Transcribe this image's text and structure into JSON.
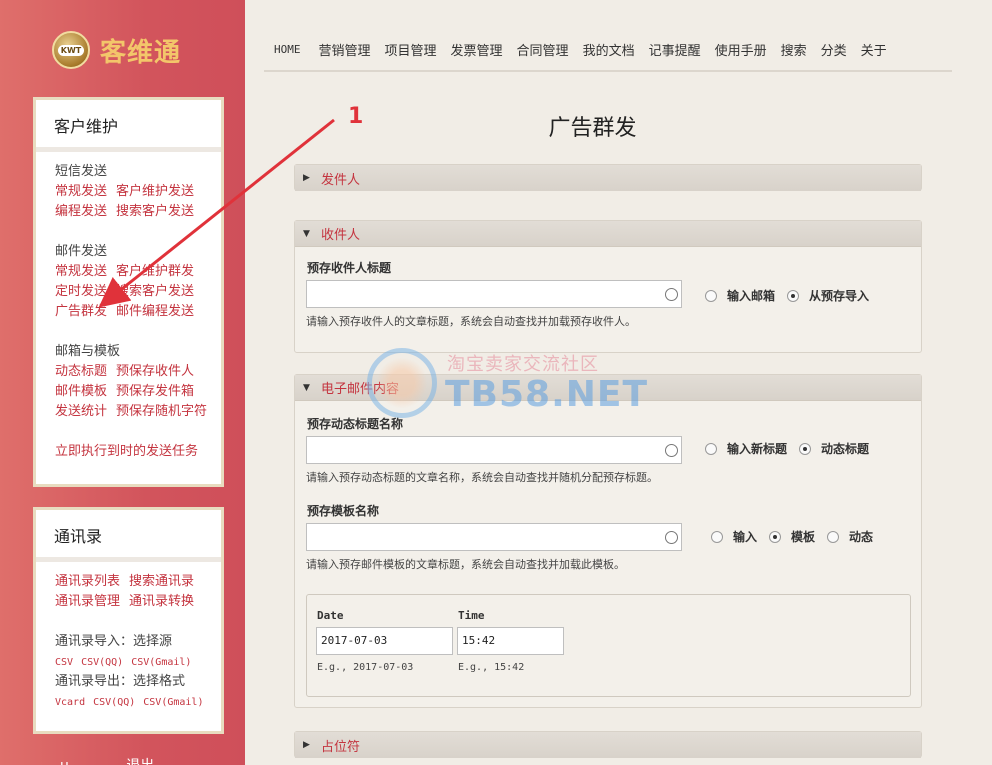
{
  "app": {
    "logo_badge": "KWT",
    "logo_text": "客维通"
  },
  "topnav": [
    "HOME",
    "营销管理",
    "项目管理",
    "发票管理",
    "合同管理",
    "我的文档",
    "记事提醒",
    "使用手册",
    "搜索",
    "分类",
    "关于"
  ],
  "page_title": "广告群发",
  "annotation": {
    "number": "1"
  },
  "sidebar": {
    "panel1": {
      "title": "客户维护",
      "sms_title": "短信发送",
      "sms_links": [
        [
          "常规发送",
          "客户维护发送"
        ],
        [
          "编程发送",
          "搜索客户发送"
        ]
      ],
      "mail_title": "邮件发送",
      "mail_links": [
        [
          "常规发送",
          "客户维护群发"
        ],
        [
          "定时发送",
          "搜索客户发送"
        ],
        [
          "广告群发",
          "邮件编程发送"
        ]
      ],
      "box_title": "邮箱与模板",
      "box_links": [
        [
          "动态标题",
          "预保存收件人"
        ],
        [
          "邮件模板",
          "预保存发件箱"
        ],
        [
          "发送统计",
          "预保存随机字符"
        ]
      ],
      "run_link": "立即执行到时的发送任务"
    },
    "panel2": {
      "title": "通讯录",
      "links": [
        [
          "通讯录列表",
          "搜索通讯录"
        ],
        [
          "通讯录管理",
          "通讯录转换"
        ]
      ],
      "import_title": "通讯录导入：选择源",
      "import_links": [
        "CSV",
        "CSV(QQ)",
        "CSV(Gmail)"
      ],
      "export_title": "通讯录导出：选择格式",
      "export_links": [
        "Vcard",
        "CSV(QQ)",
        "CSV(Gmail)"
      ]
    },
    "bottom": [
      "u",
      "...",
      "退出"
    ]
  },
  "sections": {
    "sender": {
      "label": "发件人"
    },
    "recipient": {
      "label": "收件人",
      "field_label": "预存收件人标题",
      "value": "",
      "hint": "请输入预存收件人的文章标题，系统会自动查找并加载预存收件人。",
      "radios": [
        {
          "label": "输入邮箱",
          "on": false
        },
        {
          "label": "从预存导入",
          "on": true
        }
      ]
    },
    "email": {
      "label": "电子邮件内容",
      "title_field_label": "预存动态标题名称",
      "title_value": "",
      "title_hint": "请输入预存动态标题的文章名称，系统会自动查找并随机分配预存标题。",
      "title_radios": [
        {
          "label": "输入新标题",
          "on": false
        },
        {
          "label": "动态标题",
          "on": true
        }
      ],
      "template_field_label": "预存模板名称",
      "template_value": "",
      "template_hint": "请输入预存邮件模板的文章标题，系统会自动查找并加载此模板。",
      "template_radios": [
        {
          "label": "输入",
          "on": false
        },
        {
          "label": "模板",
          "on": true
        },
        {
          "label": "动态",
          "on": false
        }
      ],
      "date_label": "Date",
      "date_value": "2017-07-03",
      "date_hint": "E.g., 2017-07-03",
      "time_label": "Time",
      "time_value": "15:42",
      "time_hint": "E.g., 15:42"
    },
    "placeholder": {
      "label": "占位符"
    }
  },
  "watermark": {
    "cn": "淘宝卖家交流社区",
    "en": "TB58.NET"
  },
  "colors": {
    "sidebar": "#d2545c",
    "link": "#c4343f",
    "logo": "#f3c66a",
    "annotation": "#e0323a"
  }
}
